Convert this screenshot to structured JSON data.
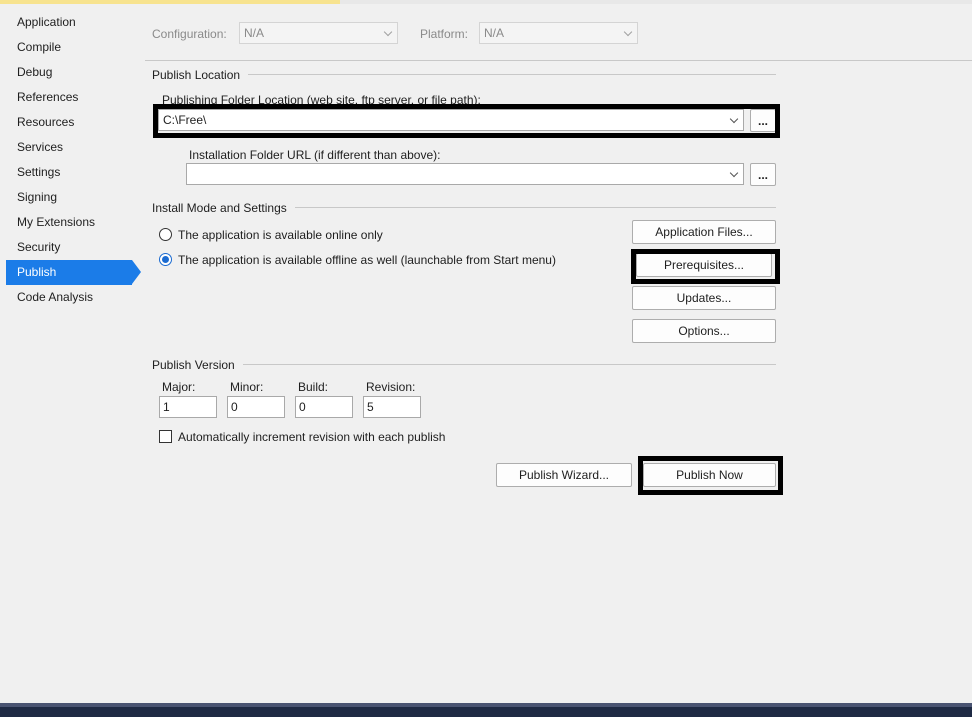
{
  "nav": {
    "items": [
      {
        "label": "Application",
        "active": false
      },
      {
        "label": "Compile",
        "active": false
      },
      {
        "label": "Debug",
        "active": false
      },
      {
        "label": "References",
        "active": false
      },
      {
        "label": "Resources",
        "active": false
      },
      {
        "label": "Services",
        "active": false
      },
      {
        "label": "Settings",
        "active": false
      },
      {
        "label": "Signing",
        "active": false
      },
      {
        "label": "My Extensions",
        "active": false
      },
      {
        "label": "Security",
        "active": false
      },
      {
        "label": "Publish",
        "active": true
      },
      {
        "label": "Code Analysis",
        "active": false
      }
    ]
  },
  "config": {
    "configuration_label": "Configuration:",
    "configuration_value": "N/A",
    "platform_label": "Platform:",
    "platform_value": "N/A"
  },
  "publish_location": {
    "title": "Publish Location",
    "folder_label": "Publishing Folder Location (web site, ftp server, or file path):",
    "folder_value": "C:\\Free\\",
    "install_url_label": "Installation Folder URL (if different than above):",
    "install_url_value": "",
    "browse_label": "..."
  },
  "install_mode": {
    "title": "Install Mode and Settings",
    "option_online": "The application is available online only",
    "option_offline": "The application is available offline as well (launchable from Start menu)",
    "selected": "offline",
    "buttons": {
      "application_files": "Application Files...",
      "prerequisites": "Prerequisites...",
      "updates": "Updates...",
      "options": "Options..."
    }
  },
  "publish_version": {
    "title": "Publish Version",
    "major_label": "Major:",
    "major_value": "1",
    "minor_label": "Minor:",
    "minor_value": "0",
    "build_label": "Build:",
    "build_value": "0",
    "revision_label": "Revision:",
    "revision_value": "5",
    "auto_increment_label": "Automatically increment revision with each publish",
    "auto_increment_checked": false
  },
  "actions": {
    "publish_wizard": "Publish Wizard...",
    "publish_now": "Publish Now"
  },
  "colors": {
    "accent": "#1b7ce8",
    "highlight_box": "#000000"
  }
}
